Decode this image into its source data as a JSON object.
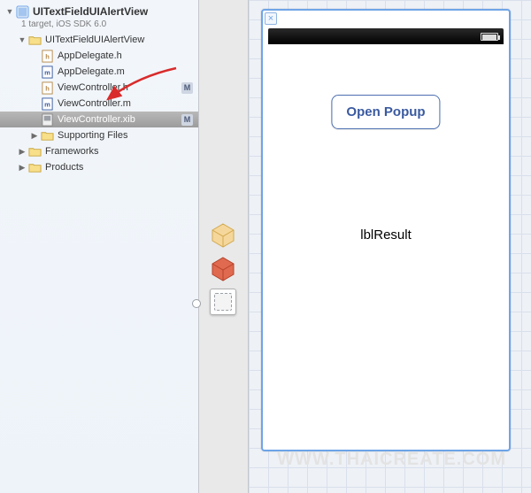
{
  "project": {
    "name": "UITextFieldUIAlertView",
    "subtitle": "1 target, iOS SDK 6.0"
  },
  "tree": {
    "group": "UITextFieldUIAlertView",
    "files": [
      {
        "name": "AppDelegate.h",
        "type": "h"
      },
      {
        "name": "AppDelegate.m",
        "type": "m"
      },
      {
        "name": "ViewController.h",
        "type": "h",
        "modified": true
      },
      {
        "name": "ViewController.m",
        "type": "m"
      },
      {
        "name": "ViewController.xib",
        "type": "xib",
        "modified": true,
        "selected": true
      }
    ],
    "supporting": "Supporting Files",
    "frameworks": "Frameworks",
    "products": "Products"
  },
  "status_badge": "M",
  "canvas": {
    "button": "Open Popup",
    "label": "lblResult"
  },
  "watermark": "WWW.THAICREATE.COM"
}
